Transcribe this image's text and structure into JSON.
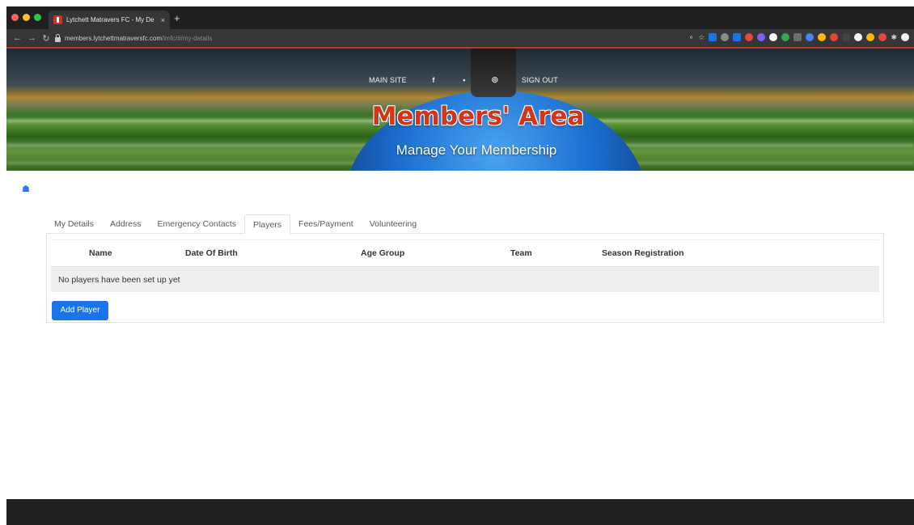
{
  "browser": {
    "tab_title": "Lytchett Matravers FC - My De",
    "tab_close": "×",
    "new_tab": "+",
    "url_host": "members.lytchettmatraversfc.com",
    "url_path": "/lmfc/#/my-details",
    "traffic_colors": [
      "#ff5f57",
      "#febc2e",
      "#28c840"
    ],
    "extension_colors": [
      "#c9c9c9",
      "#1a73e8",
      "#8a8a8a",
      "#1a73e8",
      "#e8453c",
      "#7b61ff",
      "#f5f5f5",
      "#34a853",
      "#6d6d6d",
      "#4285f4",
      "#fbbc05",
      "#ea4335",
      "#444444",
      "#f5f5f5",
      "#fbbc05",
      "#e8453c",
      "#f5f5f5"
    ]
  },
  "hero": {
    "nav_main_site": "MAIN SITE",
    "nav_facebook": "f",
    "nav_twitter": "•",
    "nav_instagram": "◎",
    "nav_sign_out": "SIGN OUT",
    "title": "Members' Area",
    "subtitle": "Manage Your Membership"
  },
  "tabs": {
    "my_details": "My Details",
    "address": "Address",
    "emergency_contacts": "Emergency Contacts",
    "players": "Players",
    "fees_payment": "Fees/Payment",
    "volunteering": "Volunteering",
    "active": "Players"
  },
  "table": {
    "col_name": "Name",
    "col_dob": "Date Of Birth",
    "col_age_group": "Age Group",
    "col_team": "Team",
    "col_season_registration": "Season Registration",
    "empty_message": "No players have been set up yet"
  },
  "actions": {
    "add_player": "Add Player"
  },
  "colors": {
    "accent": "#1a73e8",
    "title_red": "#d13618"
  }
}
